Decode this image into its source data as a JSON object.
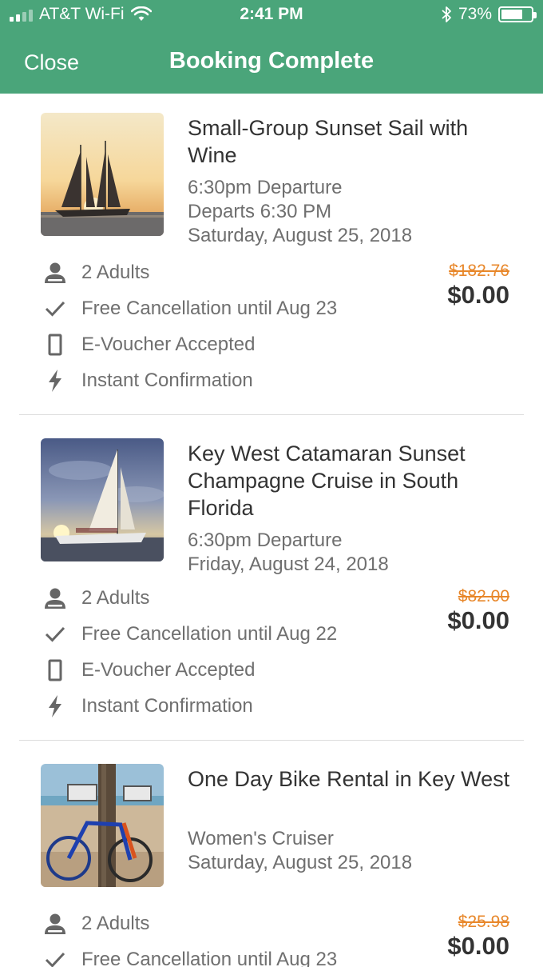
{
  "status_bar": {
    "carrier": "AT&T Wi-Fi",
    "time": "2:41 PM",
    "battery": "73%",
    "battery_level": 0.73,
    "signal_bars": 2,
    "icons": [
      "wifi-icon",
      "bluetooth-icon",
      "battery-icon"
    ]
  },
  "nav": {
    "close_label": "Close",
    "title": "Booking Complete"
  },
  "colors": {
    "header": "#4aa57a",
    "strike_price": "#e8872a",
    "secondary_text": "#6f6f6f"
  },
  "bookings": [
    {
      "title": "Small-Group Sunset Sail with Wine",
      "details": [
        "6:30pm Departure",
        "Departs 6:30 PM",
        "Saturday, August 25, 2018"
      ],
      "image": "sunset-sailboat-photo",
      "features": [
        {
          "icon": "person-icon",
          "label": "2 Adults"
        },
        {
          "icon": "checkmark-icon",
          "label": "Free Cancellation until Aug 23"
        },
        {
          "icon": "phone-icon",
          "label": "E-Voucher Accepted"
        },
        {
          "icon": "lightning-icon",
          "label": "Instant Confirmation"
        }
      ],
      "original_price": "$182.76",
      "price": "$0.00"
    },
    {
      "title": "Key West Catamaran Sunset Champagne Cruise in South Florida",
      "details": [
        "6:30pm Departure",
        "Friday, August 24, 2018"
      ],
      "image": "catamaran-photo",
      "features": [
        {
          "icon": "person-icon",
          "label": "2 Adults"
        },
        {
          "icon": "checkmark-icon",
          "label": "Free Cancellation until Aug 22"
        },
        {
          "icon": "phone-icon",
          "label": "E-Voucher Accepted"
        },
        {
          "icon": "lightning-icon",
          "label": "Instant Confirmation"
        }
      ],
      "original_price": "$82.00",
      "price": "$0.00"
    },
    {
      "title": "One Day Bike Rental in Key West",
      "details": [
        "Women's Cruiser",
        "Saturday, August 25, 2018"
      ],
      "image": "beach-bikes-photo",
      "features": [
        {
          "icon": "person-icon",
          "label": "2 Adults"
        },
        {
          "icon": "checkmark-icon",
          "label": "Free Cancellation until Aug 23"
        }
      ],
      "original_price": "$25.98",
      "price": "$0.00"
    }
  ]
}
